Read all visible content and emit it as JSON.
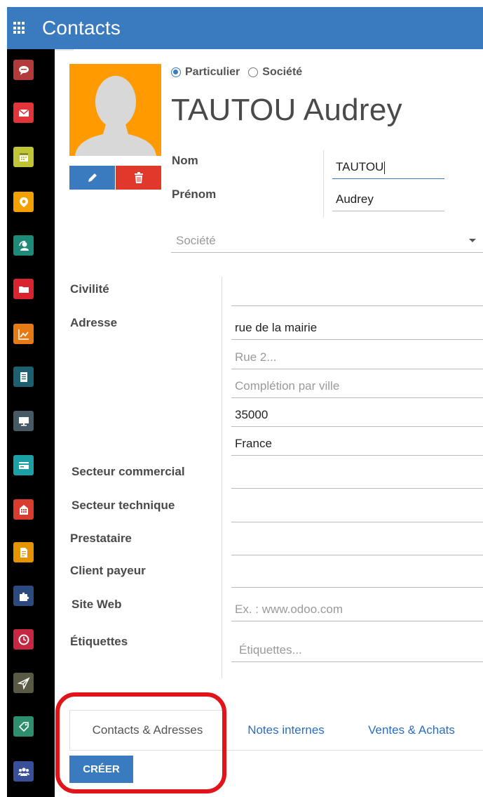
{
  "header": {
    "title": "Contacts",
    "apps_icon": "grid-icon"
  },
  "sidebar": {
    "items": [
      {
        "name": "chat",
        "icon": "chat-icon",
        "color": "#b23a3a"
      },
      {
        "name": "mail",
        "icon": "mail-icon",
        "color": "#e3343a"
      },
      {
        "name": "calendar",
        "icon": "calendar-icon",
        "color": "#c0c536"
      },
      {
        "name": "maps",
        "icon": "map-pin-icon",
        "color": "#f2a100"
      },
      {
        "name": "contacts",
        "icon": "headset-icon",
        "color": "#1e8a78"
      },
      {
        "name": "documents",
        "icon": "folder-icon",
        "color": "#d9232f"
      },
      {
        "name": "reporting",
        "icon": "chart-icon",
        "color": "#e87a14"
      },
      {
        "name": "sheets",
        "icon": "sheet-icon",
        "color": "#1c5f6e"
      },
      {
        "name": "pos",
        "icon": "monitor-icon",
        "color": "#455a64"
      },
      {
        "name": "invoicing",
        "icon": "card-icon",
        "color": "#1aa0a5"
      },
      {
        "name": "website",
        "icon": "globe-icon",
        "color": "#d93b2f"
      },
      {
        "name": "notes",
        "icon": "document-icon",
        "color": "#e59400"
      },
      {
        "name": "apps",
        "icon": "puzzle-icon",
        "color": "#2a4a80"
      },
      {
        "name": "timesheet",
        "icon": "clock-icon",
        "color": "#c62844"
      },
      {
        "name": "discuss",
        "icon": "send-icon",
        "color": "#5a5a44"
      },
      {
        "name": "tags",
        "icon": "tag-icon",
        "color": "#2d8f6e"
      },
      {
        "name": "employees",
        "icon": "users-icon",
        "color": "#3a4f9a"
      }
    ]
  },
  "form": {
    "type_options": [
      {
        "label": "Particulier",
        "checked": true
      },
      {
        "label": "Société",
        "checked": false
      }
    ],
    "display_name": "TAUTOU Audrey",
    "nom_label": "Nom",
    "nom_value": "TAUTOU",
    "prenom_label": "Prénom",
    "prenom_value": "Audrey",
    "societe_placeholder": "Société",
    "civilite_label": "Civilité",
    "adresse_label": "Adresse",
    "street": "rue de la mairie",
    "street2_placeholder": "Rue 2...",
    "city_placeholder": "Complétion par ville",
    "zip": "35000",
    "country": "France",
    "secteur_commercial_label": "Secteur commercial",
    "secteur_technique_label": "Secteur technique",
    "prestataire_label": "Prestataire",
    "client_payeur_label": "Client payeur",
    "site_web_label": "Site Web",
    "site_web_placeholder": "Ex. : www.odoo.com",
    "etiquettes_label": "Étiquettes",
    "etiquettes_placeholder": "Étiquettes..."
  },
  "tabs": [
    {
      "label": "Contacts & Adresses",
      "active": true
    },
    {
      "label": "Notes internes",
      "active": false
    },
    {
      "label": "Ventes & Achats",
      "active": false
    }
  ],
  "create_button": "CRÉER",
  "colors": {
    "brand": "#3a7bbf",
    "avatar_bg": "#ff9b00",
    "danger": "#e0392b",
    "highlight": "#e01419"
  }
}
